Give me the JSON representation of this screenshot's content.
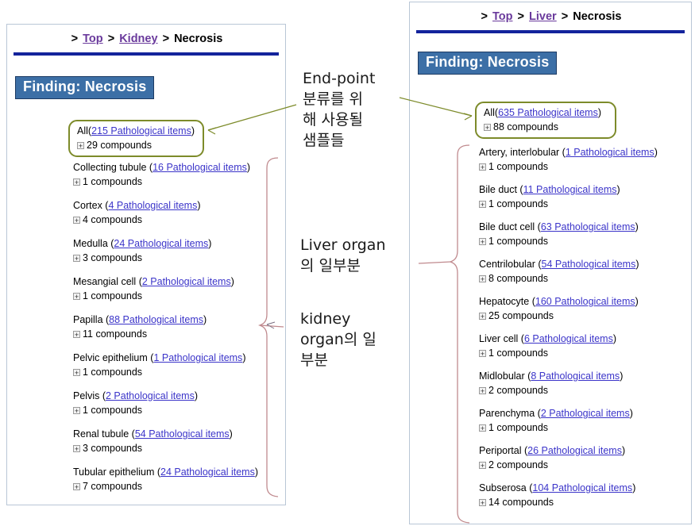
{
  "colors": {
    "header_blue": "#3c6fa6",
    "rule_blue": "#13239c",
    "link_blue": "#3b34c9",
    "breadcrumb_link": "#6a3a9c",
    "highlight_box": "#7d8b2a",
    "brace_pink": "#c08a8e",
    "arrow_olive": "#7d8b2a",
    "panel_border": "#b9c6d6"
  },
  "panels": {
    "kidney": {
      "breadcrumb": {
        "prefix": ">",
        "links": [
          "Top",
          "Kidney"
        ],
        "separator": ">",
        "current": "Necrosis"
      },
      "finding_header": "Finding: Necrosis",
      "all_entry": {
        "name": "All",
        "open_paren": "(",
        "items_link": "215 Pathological items",
        "close_paren": ")",
        "plus": "+",
        "compounds": "29 compounds"
      },
      "entries": [
        {
          "name": "Collecting tubule",
          "items_link": "16 Pathological items",
          "plus": "+",
          "compounds": "1 compounds"
        },
        {
          "name": "Cortex",
          "items_link": "4 Pathological items",
          "plus": "+",
          "compounds": "4 compounds"
        },
        {
          "name": "Medulla",
          "items_link": "24 Pathological items",
          "plus": "+",
          "compounds": "3 compounds"
        },
        {
          "name": "Mesangial cell",
          "items_link": "2 Pathological items",
          "plus": "+",
          "compounds": "1 compounds"
        },
        {
          "name": "Papilla",
          "items_link": "88 Pathological items",
          "plus": "+",
          "compounds": "11 compounds"
        },
        {
          "name": "Pelvic epithelium",
          "items_link": "1 Pathological items",
          "plus": "+",
          "compounds": "1 compounds"
        },
        {
          "name": "Pelvis",
          "items_link": "2 Pathological items",
          "plus": "+",
          "compounds": "1 compounds"
        },
        {
          "name": "Renal tubule",
          "items_link": "54 Pathological items",
          "plus": "+",
          "compounds": "3 compounds"
        },
        {
          "name": "Tubular epithelium",
          "items_link": "24 Pathological items",
          "plus": "+",
          "compounds": "7 compounds"
        }
      ]
    },
    "liver": {
      "breadcrumb": {
        "prefix": ">",
        "links": [
          "Top",
          "Liver"
        ],
        "separator": ">",
        "current": "Necrosis"
      },
      "finding_header": "Finding: Necrosis",
      "all_entry": {
        "name": "All",
        "open_paren": "(",
        "items_link": "635 Pathological items",
        "close_paren": ")",
        "plus": "+",
        "compounds": "88 compounds"
      },
      "entries": [
        {
          "name": "Artery, interlobular",
          "items_link": "1 Pathological items",
          "plus": "+",
          "compounds": "1 compounds"
        },
        {
          "name": "Bile duct",
          "items_link": "11 Pathological items",
          "plus": "+",
          "compounds": "1 compounds"
        },
        {
          "name": "Bile duct cell",
          "items_link": "63 Pathological items",
          "plus": "+",
          "compounds": "1 compounds"
        },
        {
          "name": "Centrilobular",
          "items_link": "54 Pathological items",
          "plus": "+",
          "compounds": "8 compounds"
        },
        {
          "name": "Hepatocyte",
          "items_link": "160 Pathological items",
          "plus": "+",
          "compounds": "25 compounds"
        },
        {
          "name": "Liver cell",
          "items_link": "6 Pathological items",
          "plus": "+",
          "compounds": "1 compounds"
        },
        {
          "name": "Midlobular",
          "items_link": "8 Pathological items",
          "plus": "+",
          "compounds": "2 compounds"
        },
        {
          "name": "Parenchyma",
          "items_link": "2 Pathological items",
          "plus": "+",
          "compounds": "1 compounds"
        },
        {
          "name": "Periportal",
          "items_link": "26 Pathological items",
          "plus": "+",
          "compounds": "2 compounds"
        },
        {
          "name": "Subserosa",
          "items_link": "104 Pathological items",
          "plus": "+",
          "compounds": "14 compounds"
        }
      ]
    }
  },
  "annotations": {
    "endpoint": "End-point\n분류를 위\n해 사용될\n샘플들",
    "liver_organ": "Liver organ\n의 일부분",
    "kidney_organ": "kidney\norgan의 일\n부분"
  }
}
